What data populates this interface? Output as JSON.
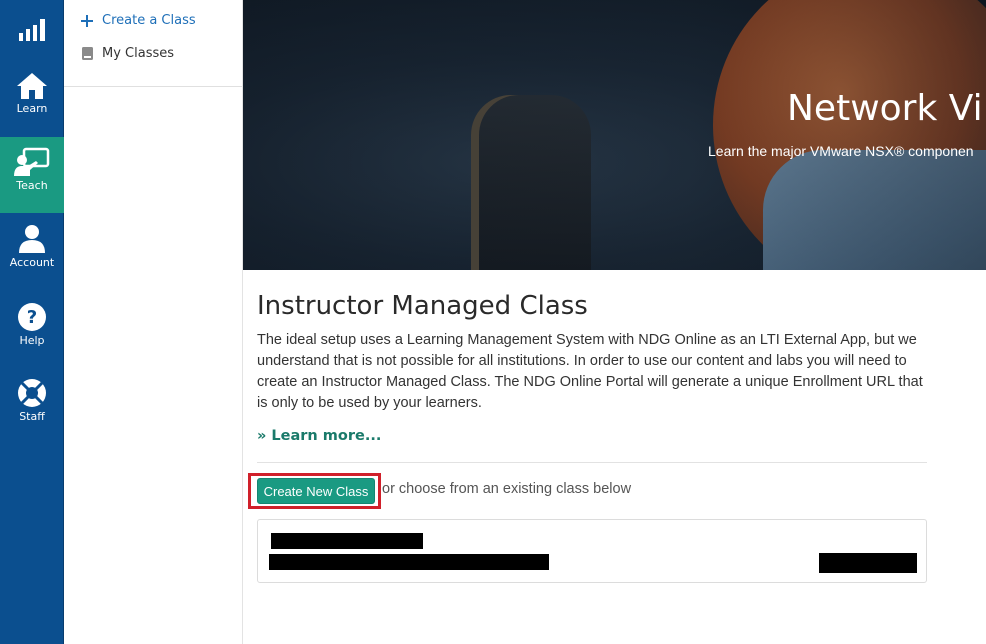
{
  "rail": {
    "logo_icon": "signal-bars-icon",
    "items": [
      {
        "label": "Learn",
        "icon": "home-icon",
        "active": false
      },
      {
        "label": "Teach",
        "icon": "presenter-icon",
        "active": true
      },
      {
        "label": "Account",
        "icon": "user-icon",
        "active": false
      },
      {
        "label": "Help",
        "icon": "question-icon",
        "active": false
      },
      {
        "label": "Staff",
        "icon": "lifebuoy-icon",
        "active": false
      }
    ]
  },
  "subnav": {
    "create_label": "Create a Class",
    "my_classes_label": "My Classes"
  },
  "hero": {
    "title": "Network Vi",
    "subtitle": "Learn the major VMware NSX® componen"
  },
  "main": {
    "title": "Instructor Managed Class",
    "intro": "The ideal setup uses a Learning Management System with NDG Online as an LTI External App, but we understand that is not possible for all institutions. In order to use our content and labs you will need to create an Instructor Managed Class. The NDG Online Portal will generate a unique Enrollment URL that is only to be used by your learners.",
    "learn_more": "» Learn more...",
    "create_button": "Create New Class",
    "choose_text": "or choose from an existing class below"
  },
  "colors": {
    "rail_bg": "#0b4f8f",
    "active_teal": "#1a9a82",
    "link_blue": "#1e6fb8",
    "highlight_red": "#d0202a"
  }
}
